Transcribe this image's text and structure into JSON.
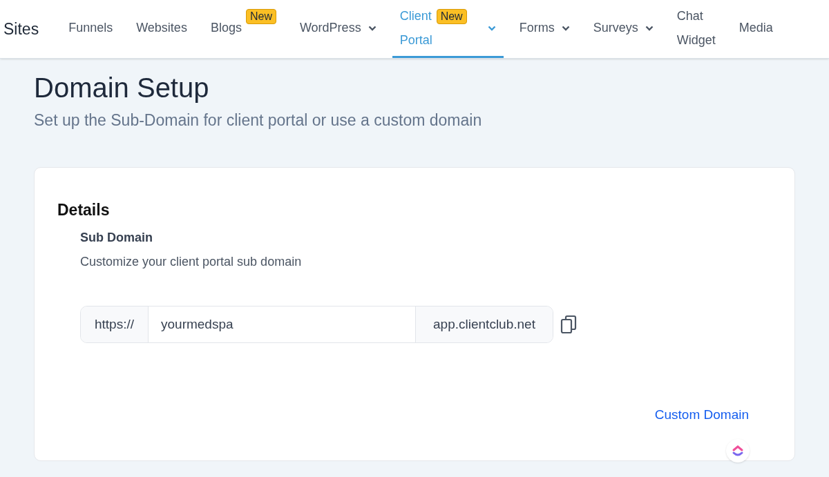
{
  "nav": {
    "brand": "Sites",
    "items": [
      {
        "label": "Funnels",
        "selected": false,
        "dropdown": false
      },
      {
        "label": "Websites",
        "selected": false,
        "dropdown": false
      },
      {
        "label": "Blogs",
        "selected": false,
        "dropdown": false,
        "badge": "New"
      },
      {
        "label": "WordPress",
        "selected": false,
        "dropdown": true
      },
      {
        "label": "Client Portal",
        "selected": true,
        "dropdown": true,
        "badge": "New"
      },
      {
        "label": "Forms",
        "selected": false,
        "dropdown": true
      },
      {
        "label": "Surveys",
        "selected": false,
        "dropdown": true
      },
      {
        "label": "Chat Widget",
        "selected": false,
        "dropdown": false
      },
      {
        "label": "Media",
        "selected": false,
        "dropdown": false
      }
    ]
  },
  "page": {
    "title": "Domain Setup",
    "subtitle": "Set up the Sub-Domain for client portal or use a custom domain"
  },
  "card": {
    "heading": "Details",
    "field_label": "Sub Domain",
    "field_description": "Customize your client portal sub domain",
    "domain_input": {
      "prefix": "https://",
      "value": "yourmedspa",
      "suffix": "app.clientclub.net"
    },
    "link": "Custom Domain"
  }
}
